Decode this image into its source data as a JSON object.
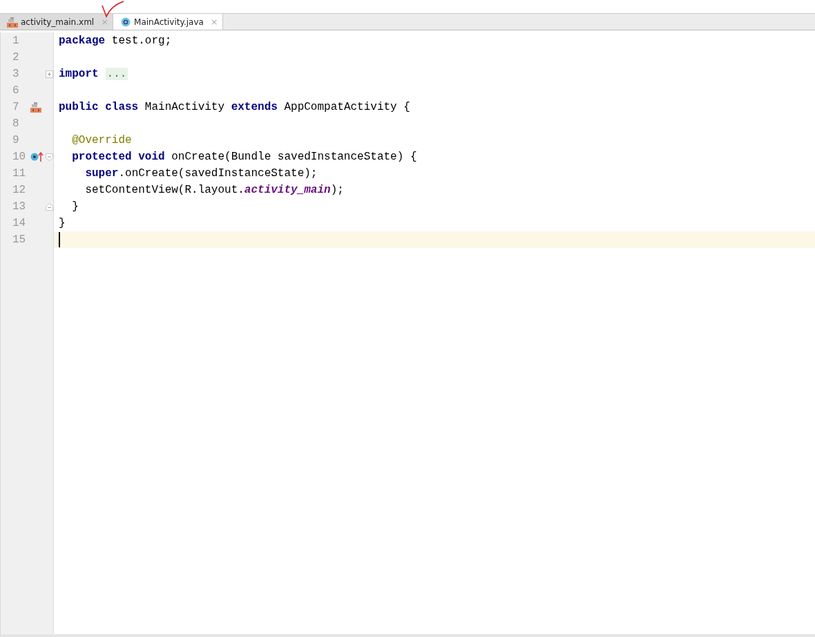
{
  "tabs": [
    {
      "label": "activity_main.xml",
      "kind": "layout",
      "selected": false,
      "close": "×"
    },
    {
      "label": "MainActivity.java",
      "kind": "class",
      "selected": true,
      "close": "×"
    }
  ],
  "annotation": {
    "kind": "checkmark"
  },
  "lines": [
    {
      "number": "1",
      "tokens": [
        {
          "kind": "keyword",
          "text": "package"
        },
        {
          "kind": "plain",
          "text": " test.org;"
        }
      ]
    },
    {
      "number": "2"
    },
    {
      "number": "3",
      "gutter_marks": [
        {
          "kind": "expand"
        }
      ],
      "tokens": [
        {
          "kind": "keyword",
          "text": "import"
        },
        {
          "kind": "folded",
          "text": "..."
        }
      ]
    },
    {
      "number": "6"
    },
    {
      "number": "7",
      "gutter_marks": [
        {
          "kind": "layout"
        }
      ],
      "tokens": [
        {
          "kind": "keyword",
          "text": "public class"
        },
        {
          "kind": "plain",
          "text": " MainActivity "
        },
        {
          "kind": "keyword",
          "text": "extends"
        },
        {
          "kind": "plain",
          "text": " AppCompatActivity {"
        }
      ]
    },
    {
      "number": "8"
    },
    {
      "number": "9",
      "tokens": [
        {
          "kind": "annotation",
          "text": "  @Override"
        }
      ]
    },
    {
      "number": "10",
      "gutter_marks": [
        {
          "kind": "override"
        },
        {
          "kind": "fold_start"
        }
      ],
      "tokens": [
        {
          "kind": "keyword",
          "text": "  protected void"
        },
        {
          "kind": "plain",
          "text": " onCreate(Bundle savedInstanceState) {"
        }
      ]
    },
    {
      "number": "11",
      "tokens": [
        {
          "kind": "keyword",
          "text": "    super"
        },
        {
          "kind": "plain",
          "text": ".onCreate(savedInstanceState);"
        }
      ]
    },
    {
      "number": "12",
      "tokens": [
        {
          "kind": "plain",
          "text": "    setContentView(R.layout."
        },
        {
          "kind": "field",
          "text": "activity_main"
        },
        {
          "kind": "plain",
          "text": ");"
        }
      ]
    },
    {
      "number": "13",
      "gutter_marks": [
        {
          "kind": "fold_end"
        }
      ],
      "tokens": [
        {
          "kind": "plain",
          "text": "  }"
        }
      ]
    },
    {
      "number": "14",
      "tokens": [
        {
          "kind": "plain",
          "text": "}"
        }
      ]
    },
    {
      "number": "15",
      "current": true
    }
  ]
}
